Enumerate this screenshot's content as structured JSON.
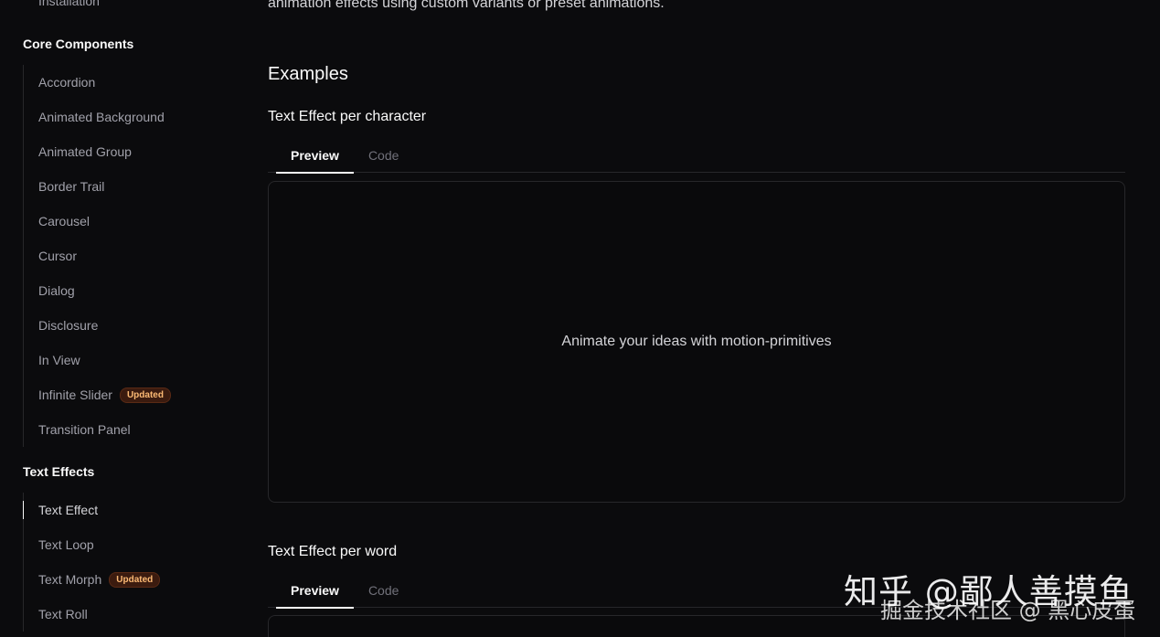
{
  "sidebar": {
    "top_item": "Installation",
    "groups": [
      {
        "title": "Core Components",
        "items": [
          {
            "label": "Accordion"
          },
          {
            "label": "Animated Background"
          },
          {
            "label": "Animated Group"
          },
          {
            "label": "Border Trail"
          },
          {
            "label": "Carousel"
          },
          {
            "label": "Cursor"
          },
          {
            "label": "Dialog"
          },
          {
            "label": "Disclosure"
          },
          {
            "label": "In View"
          },
          {
            "label": "Infinite Slider",
            "badge": "Updated"
          },
          {
            "label": "Transition Panel"
          }
        ]
      },
      {
        "title": "Text Effects",
        "items": [
          {
            "label": "Text Effect",
            "active": true
          },
          {
            "label": "Text Loop"
          },
          {
            "label": "Text Morph",
            "badge": "Updated"
          },
          {
            "label": "Text Roll"
          }
        ]
      }
    ]
  },
  "main": {
    "intro": "animation effects using custom variants or preset animations.",
    "examples_heading": "Examples",
    "examples": [
      {
        "title": "Text Effect per character",
        "tabs": [
          "Preview",
          "Code"
        ],
        "active_tab": "Preview",
        "preview_text": "Animate your ideas with motion-primitives"
      },
      {
        "title": "Text Effect per word",
        "tabs": [
          "Preview",
          "Code"
        ],
        "active_tab": "Preview",
        "preview_text": ""
      }
    ]
  },
  "watermark": {
    "line1": "知乎 @鄙人善摸鱼",
    "line2": "掘金技术社区 @ 黑心皮蛋"
  },
  "colors": {
    "background": "#0b0b0d",
    "badge_bg": "#3b1b0f",
    "badge_text": "#fdba74",
    "border": "#27272a"
  }
}
